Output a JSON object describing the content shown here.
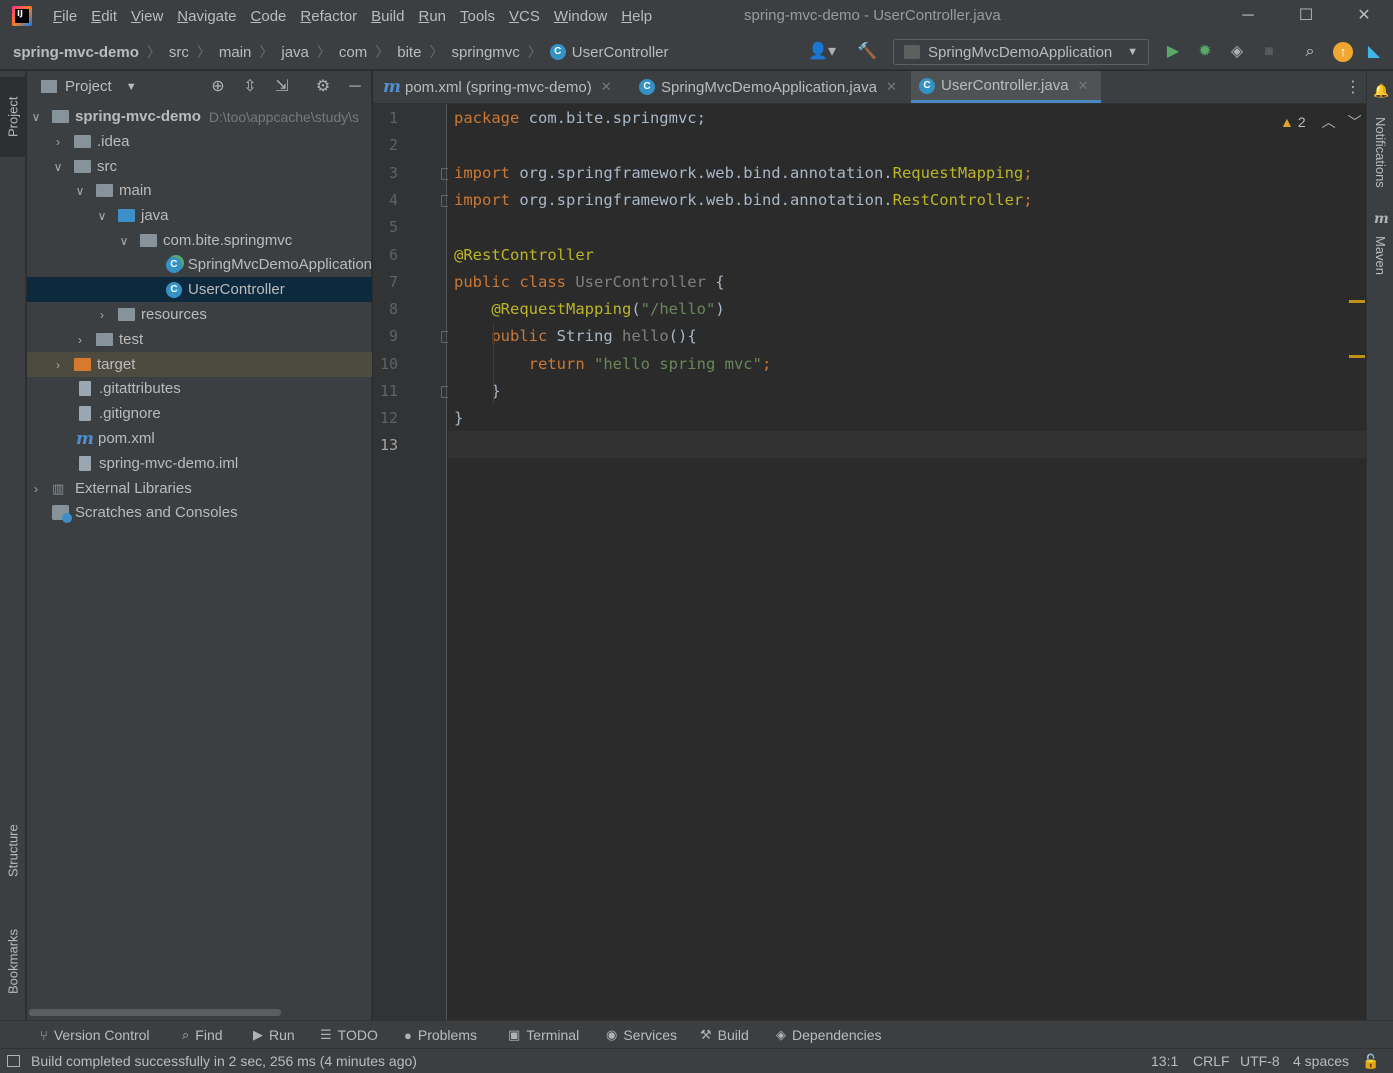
{
  "menu": [
    "File",
    "Edit",
    "View",
    "Navigate",
    "Code",
    "Refactor",
    "Build",
    "Run",
    "Tools",
    "VCS",
    "Window",
    "Help"
  ],
  "window_title": "spring-mvc-demo - UserController.java",
  "breadcrumb": [
    "spring-mvc-demo",
    "src",
    "main",
    "java",
    "com",
    "bite",
    "springmvc",
    "UserController"
  ],
  "run_config": "SpringMvcDemoApplication",
  "left_tabs": {
    "project": "Project",
    "structure": "Structure",
    "bookmarks": "Bookmarks"
  },
  "right_tabs": {
    "notifications": "Notifications",
    "maven": "Maven"
  },
  "project_panel": {
    "title": "Project",
    "root_path": "D:\\too\\appcache\\study\\s",
    "tree": [
      "spring-mvc-demo",
      ".idea",
      "src",
      "main",
      "java",
      "com.bite.springmvc",
      "SpringMvcDemoApplication",
      "UserController",
      "resources",
      "test",
      "target",
      ".gitattributes",
      ".gitignore",
      "pom.xml",
      "spring-mvc-demo.iml",
      "External Libraries",
      "Scratches and Consoles"
    ]
  },
  "editor_tabs": [
    "pom.xml (spring-mvc-demo)",
    "SpringMvcDemoApplication.java",
    "UserController.java"
  ],
  "editor": {
    "line_numbers": [
      "1",
      "2",
      "3",
      "4",
      "5",
      "6",
      "7",
      "8",
      "9",
      "10",
      "11",
      "12",
      "13"
    ],
    "warning_count": "2",
    "code": {
      "l1_kw": "package",
      "l1_rest": " com.bite.springmvc;",
      "l3_kw": "import",
      "l3_pkg": " org.springframework.web.bind.annotation.",
      "l3_cls": "RequestMapping",
      "l3_end": ";",
      "l4_kw": "import",
      "l4_pkg": " org.springframework.web.bind.annotation.",
      "l4_cls": "RestController",
      "l4_end": ";",
      "l6_ann": "@RestController",
      "l7_kw": "public class",
      "l7_name": " UserController",
      "l7_end": " {",
      "l8_ann": "    @RequestMapping",
      "l8_p1": "(",
      "l8_str": "\"/hello\"",
      "l8_p2": ")",
      "l9_kw": "    public",
      "l9_type": " String",
      "l9_name": " hello",
      "l9_end": "(){",
      "l10_kw": "        return",
      "l10_str": " \"hello spring mvc\"",
      "l10_end": ";",
      "l11": "    }",
      "l12": "}"
    }
  },
  "bottom_tools": [
    "Version Control",
    "Find",
    "Run",
    "TODO",
    "Problems",
    "Terminal",
    "Services",
    "Build",
    "Dependencies"
  ],
  "status": {
    "message": "Build completed successfully in 2 sec, 256 ms (4 minutes ago)",
    "position": "13:1",
    "line_sep": "CRLF",
    "encoding": "UTF-8",
    "indent": "4 spaces"
  },
  "colors": {
    "accent": "#4a88c7",
    "keyword": "#cc7832",
    "annotation": "#bbb529",
    "string": "#6a8759",
    "warning": "#be9117"
  }
}
